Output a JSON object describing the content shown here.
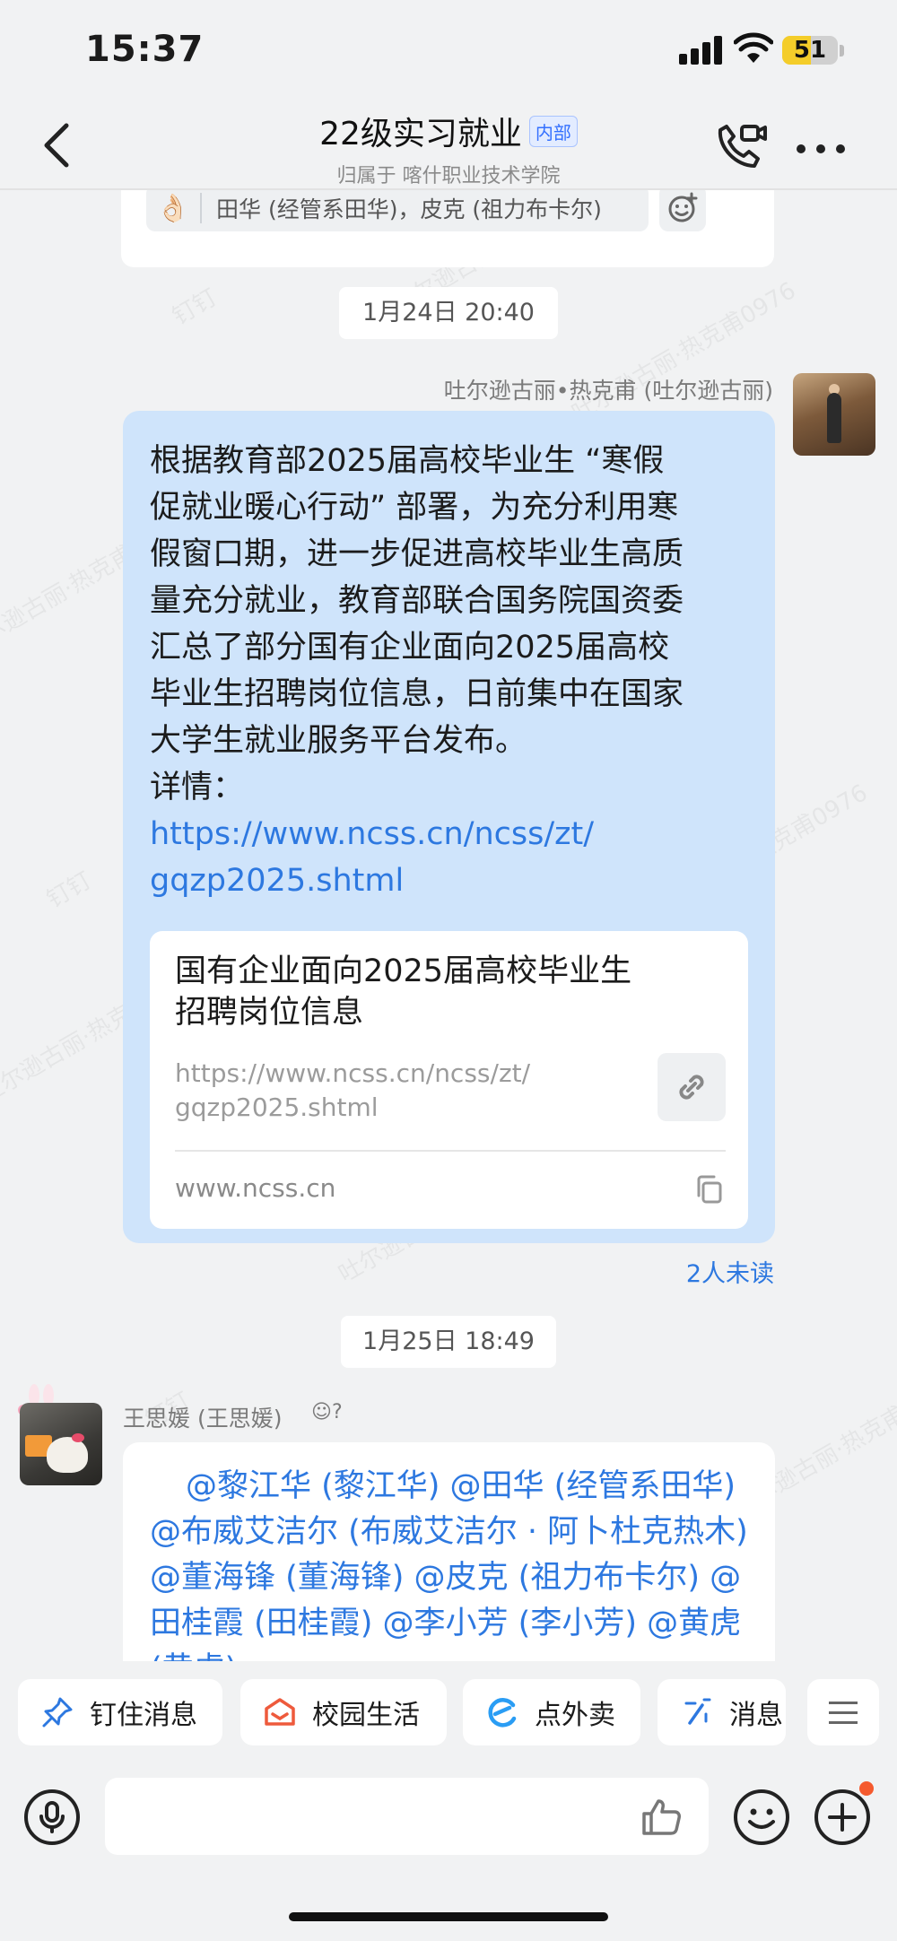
{
  "status_bar": {
    "time": "15:37",
    "battery": "51",
    "battery_level": 0.51
  },
  "header": {
    "title": "22级实习就业",
    "badge": "内部",
    "subtitle": "归属于 喀什职业技术学院"
  },
  "prev_message": {
    "reaction_emoji": "👌🏻",
    "reaction_users": "田华 (经管系田华)，皮克 (祖力布卡尔)"
  },
  "messages": [
    {
      "timestamp": "1月24日 20:40",
      "sender": "吐尔逊古丽•热克甫 (吐尔逊古丽)",
      "text": "根据教育部2025届高校毕业生 “寒假\n促就业暖心行动” 部署，为充分利用寒\n假窗口期，进一步促进高校毕业生高质\n量充分就业，教育部联合国务院国资委\n汇总了部分国有企业面向2025届高校\n毕业生招聘岗位信息，日前集中在国家\n大学生就业服务平台发布。\n详情：",
      "link": "https://www.ncss.cn/ncss/zt/\ngqzp2025.shtml",
      "card": {
        "title": "国有企业面向2025届高校毕业生\n招聘岗位信息",
        "url": "https://www.ncss.cn/ncss/zt/\ngqzp2025.shtml",
        "domain": "www.ncss.cn"
      },
      "unread": "2人未读"
    },
    {
      "timestamp": "1月25日 18:49",
      "sender": "王思媛 (王思媛)",
      "sender_status": "?",
      "text": "@黎江华 (黎江华) @田华 (经管系田华) @布威艾洁尔 (布威艾洁尔 · 阿卜杜克热木) @董海锋 (董海锋) @皮克 (祖力布卡尔) @田桂霞 (田桂霞) @李小芳 (李小芳) @黄虎 (黄虎)"
    }
  ],
  "quick_actions": [
    "钉住消息",
    "校园生活",
    "点外卖",
    "消息"
  ],
  "watermark": "吐尔逊古丽·热克甫0976",
  "watermark_brand": "钉钉",
  "colors": {
    "accent": "#2d78e0",
    "bubble_self": "#cfe4fb",
    "background": "#f1f2f3"
  }
}
